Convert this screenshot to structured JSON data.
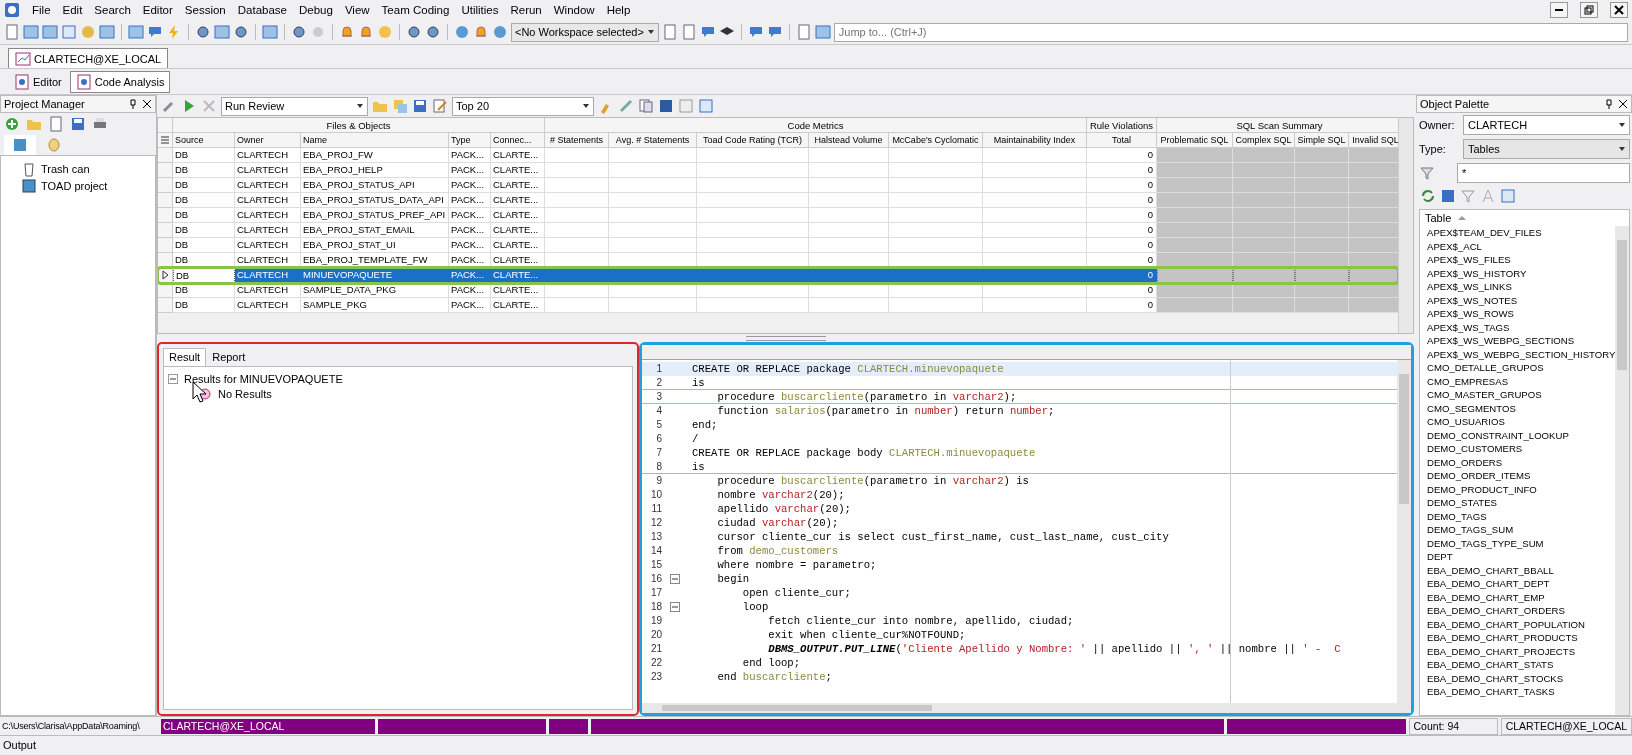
{
  "menu": [
    "File",
    "Edit",
    "Search",
    "Editor",
    "Session",
    "Database",
    "Debug",
    "View",
    "Team Coding",
    "Utilities",
    "Rerun",
    "Window",
    "Help"
  ],
  "toolbar": {
    "workspace": "<No Workspace selected>",
    "jump_placeholder": "Jump to... (Ctrl+J)"
  },
  "connection_tabs": [
    {
      "label": "CLARTECH@XE_LOCAL",
      "selected": true
    }
  ],
  "editor_tabs": [
    {
      "label": "Editor",
      "selected": false
    },
    {
      "label": "Code Analysis",
      "selected": true
    }
  ],
  "project_manager": {
    "title": "Project Manager",
    "items": [
      {
        "label": "Trash can",
        "kind": "trash"
      },
      {
        "label": "TOAD project",
        "kind": "project"
      }
    ]
  },
  "review_toolbar": {
    "action": "Run Review",
    "limit": "Top 20"
  },
  "grid": {
    "groups": [
      {
        "label": "Files & Objects",
        "columns": [
          "Source",
          "Owner",
          "Name",
          "Type",
          "Connec..."
        ]
      },
      {
        "label": "Code Metrics",
        "columns": [
          "# Statements",
          "Avg. # Statements",
          "Toad Code Rating (TCR)",
          "Halstead Volume",
          "McCabe's Cyclomatic",
          "Maintainability Index"
        ]
      },
      {
        "label": "Rule Violations",
        "columns": [
          "Total"
        ]
      },
      {
        "label": "SQL Scan Summary",
        "columns": [
          "Problematic SQL",
          "Complex SQL",
          "Simple SQL",
          "Invalid SQL"
        ]
      }
    ],
    "rows": [
      {
        "source": "DB",
        "owner": "CLARTECH",
        "name": "EBA_PROJ_FW",
        "type": "PACK...",
        "connection": "CLARTE...",
        "total": "0",
        "selected": false
      },
      {
        "source": "DB",
        "owner": "CLARTECH",
        "name": "EBA_PROJ_HELP",
        "type": "PACK...",
        "connection": "CLARTE...",
        "total": "0",
        "selected": false
      },
      {
        "source": "DB",
        "owner": "CLARTECH",
        "name": "EBA_PROJ_STATUS_API",
        "type": "PACK...",
        "connection": "CLARTE...",
        "total": "0",
        "selected": false
      },
      {
        "source": "DB",
        "owner": "CLARTECH",
        "name": "EBA_PROJ_STATUS_DATA_API",
        "type": "PACK...",
        "connection": "CLARTE...",
        "total": "0",
        "selected": false
      },
      {
        "source": "DB",
        "owner": "CLARTECH",
        "name": "EBA_PROJ_STATUS_PREF_API",
        "type": "PACK...",
        "connection": "CLARTE...",
        "total": "0",
        "selected": false
      },
      {
        "source": "DB",
        "owner": "CLARTECH",
        "name": "EBA_PROJ_STAT_EMAIL",
        "type": "PACK...",
        "connection": "CLARTE...",
        "total": "0",
        "selected": false
      },
      {
        "source": "DB",
        "owner": "CLARTECH",
        "name": "EBA_PROJ_STAT_UI",
        "type": "PACK...",
        "connection": "CLARTE...",
        "total": "0",
        "selected": false
      },
      {
        "source": "DB",
        "owner": "CLARTECH",
        "name": "EBA_PROJ_TEMPLATE_FW",
        "type": "PACK...",
        "connection": "CLARTE...",
        "total": "0",
        "selected": false
      },
      {
        "source": "DB",
        "owner": "CLARTECH",
        "name": "MINUEVOPAQUETE",
        "type": "PACK...",
        "connection": "CLARTE...",
        "total": "0",
        "selected": true
      },
      {
        "source": "DB",
        "owner": "CLARTECH",
        "name": "SAMPLE_DATA_PKG",
        "type": "PACK...",
        "connection": "CLARTE...",
        "total": "0",
        "selected": false
      },
      {
        "source": "DB",
        "owner": "CLARTECH",
        "name": "SAMPLE_PKG",
        "type": "PACK...",
        "connection": "CLARTE...",
        "total": "0",
        "selected": false
      }
    ]
  },
  "result_tabs": [
    {
      "label": "Result",
      "selected": true
    },
    {
      "label": "Report",
      "selected": false
    }
  ],
  "results_tree": {
    "label": "Results for MINUEVOPAQUETE",
    "expanded": true,
    "children": [
      {
        "label": "No Results"
      }
    ]
  },
  "code": {
    "lines": [
      {
        "number": "1",
        "current": true,
        "separator": false,
        "fold": false,
        "segments": [
          {
            "text": "CREATE OR REPLACE package ",
            "kind": "plain"
          },
          {
            "text": "CLARTECH.minuevopaquete",
            "kind": "ident"
          }
        ]
      },
      {
        "number": "2",
        "current": false,
        "separator": true,
        "fold": false,
        "segments": [
          {
            "text": "is",
            "kind": "plain"
          }
        ]
      },
      {
        "number": "3",
        "current": false,
        "separator": true,
        "fold": false,
        "segments": [
          {
            "text": "    procedure ",
            "kind": "plain"
          },
          {
            "text": "buscarcliente",
            "kind": "ident"
          },
          {
            "text": "(parametro in ",
            "kind": "plain"
          },
          {
            "text": "varchar2",
            "kind": "type"
          },
          {
            "text": ");",
            "kind": "plain"
          }
        ]
      },
      {
        "number": "4",
        "current": false,
        "separator": false,
        "fold": false,
        "segments": [
          {
            "text": "    function ",
            "kind": "plain"
          },
          {
            "text": "salarios",
            "kind": "ident"
          },
          {
            "text": "(parametro in ",
            "kind": "plain"
          },
          {
            "text": "number",
            "kind": "type"
          },
          {
            "text": ") return ",
            "kind": "plain"
          },
          {
            "text": "number",
            "kind": "type"
          },
          {
            "text": ";",
            "kind": "plain"
          }
        ]
      },
      {
        "number": "5",
        "current": false,
        "separator": false,
        "fold": false,
        "segments": [
          {
            "text": "end;",
            "kind": "plain"
          }
        ]
      },
      {
        "number": "6",
        "current": false,
        "separator": false,
        "fold": false,
        "segments": [
          {
            "text": "/",
            "kind": "plain"
          }
        ]
      },
      {
        "number": "7",
        "current": false,
        "separator": false,
        "fold": false,
        "segments": [
          {
            "text": "CREATE OR REPLACE package body ",
            "kind": "plain"
          },
          {
            "text": "CLARTECH.minuevopaquete",
            "kind": "ident"
          }
        ]
      },
      {
        "number": "8",
        "current": false,
        "separator": true,
        "fold": false,
        "segments": [
          {
            "text": "is",
            "kind": "plain"
          }
        ]
      },
      {
        "number": "9",
        "current": false,
        "separator": false,
        "fold": false,
        "segments": [
          {
            "text": "    procedure ",
            "kind": "plain"
          },
          {
            "text": "buscarcliente",
            "kind": "ident"
          },
          {
            "text": "(parametro in ",
            "kind": "plain"
          },
          {
            "text": "varchar2",
            "kind": "type"
          },
          {
            "text": ") is",
            "kind": "plain"
          }
        ]
      },
      {
        "number": "10",
        "current": false,
        "separator": false,
        "fold": false,
        "segments": [
          {
            "text": "    nombre ",
            "kind": "plain"
          },
          {
            "text": "varchar2",
            "kind": "type"
          },
          {
            "text": "(20);",
            "kind": "plain"
          }
        ]
      },
      {
        "number": "11",
        "current": false,
        "separator": false,
        "fold": false,
        "segments": [
          {
            "text": "    apellido ",
            "kind": "plain"
          },
          {
            "text": "varchar",
            "kind": "type"
          },
          {
            "text": "(20);",
            "kind": "plain"
          }
        ]
      },
      {
        "number": "12",
        "current": false,
        "separator": false,
        "fold": false,
        "segments": [
          {
            "text": "    ciudad ",
            "kind": "plain"
          },
          {
            "text": "varchar",
            "kind": "type"
          },
          {
            "text": "(20);",
            "kind": "plain"
          }
        ]
      },
      {
        "number": "13",
        "current": false,
        "separator": false,
        "fold": false,
        "segments": [
          {
            "text": "    cursor cliente_cur is select cust_first_name, cust_last_name, cust_city",
            "kind": "plain"
          }
        ]
      },
      {
        "number": "14",
        "current": false,
        "separator": false,
        "fold": false,
        "segments": [
          {
            "text": "    from ",
            "kind": "plain"
          },
          {
            "text": "demo_customers",
            "kind": "ident"
          }
        ]
      },
      {
        "number": "15",
        "current": false,
        "separator": false,
        "fold": false,
        "segments": [
          {
            "text": "    where nombre = parametro;",
            "kind": "plain"
          }
        ]
      },
      {
        "number": "16",
        "current": false,
        "separator": false,
        "fold": true,
        "segments": [
          {
            "text": "    begin",
            "kind": "plain"
          }
        ]
      },
      {
        "number": "17",
        "current": false,
        "separator": false,
        "fold": false,
        "segments": [
          {
            "text": "        open cliente_cur;",
            "kind": "plain"
          }
        ]
      },
      {
        "number": "18",
        "current": false,
        "separator": false,
        "fold": true,
        "segments": [
          {
            "text": "        loop",
            "kind": "plain"
          }
        ]
      },
      {
        "number": "19",
        "current": false,
        "separator": false,
        "fold": false,
        "segments": [
          {
            "text": "            fetch cliente_cur into nombre, apellido, ciudad;",
            "kind": "plain"
          }
        ]
      },
      {
        "number": "20",
        "current": false,
        "separator": false,
        "fold": false,
        "segments": [
          {
            "text": "            exit when cliente_cur%NOTFOUND;",
            "kind": "plain"
          }
        ]
      },
      {
        "number": "21",
        "current": false,
        "separator": false,
        "fold": false,
        "segments": [
          {
            "text": "            DBMS_OUTPUT.PUT_LINE",
            "kind": "call"
          },
          {
            "text": "(",
            "kind": "plain"
          },
          {
            "text": "'Cliente Apellido y Nombre: '",
            "kind": "str"
          },
          {
            "text": " || apellido || ",
            "kind": "plain"
          },
          {
            "text": "', '",
            "kind": "str"
          },
          {
            "text": " || nombre || ",
            "kind": "plain"
          },
          {
            "text": "' -  C",
            "kind": "str"
          }
        ]
      },
      {
        "number": "22",
        "current": false,
        "separator": false,
        "fold": false,
        "segments": [
          {
            "text": "        end loop;",
            "kind": "plain"
          }
        ]
      },
      {
        "number": "23",
        "current": false,
        "separator": false,
        "fold": false,
        "segments": [
          {
            "text": "    end ",
            "kind": "plain"
          },
          {
            "text": "buscarcliente",
            "kind": "ident"
          },
          {
            "text": ";",
            "kind": "plain"
          }
        ]
      }
    ]
  },
  "object_palette": {
    "title": "Object Palette",
    "owner_label": "Owner:",
    "owner": "CLARTECH",
    "type_label": "Type:",
    "type": "Tables",
    "filter": "*",
    "list_header": "Table",
    "items": [
      "APEX$TEAM_DEV_FILES",
      "APEX$_ACL",
      "APEX$_WS_FILES",
      "APEX$_WS_HISTORY",
      "APEX$_WS_LINKS",
      "APEX$_WS_NOTES",
      "APEX$_WS_ROWS",
      "APEX$_WS_TAGS",
      "APEX$_WS_WEBPG_SECTIONS",
      "APEX$_WS_WEBPG_SECTION_HISTORY",
      "CMO_DETALLE_GRUPOS",
      "CMO_EMPRESAS",
      "CMO_MASTER_GRUPOS",
      "CMO_SEGMENTOS",
      "CMO_USUARIOS",
      "DEMO_CONSTRAINT_LOOKUP",
      "DEMO_CUSTOMERS",
      "DEMO_ORDERS",
      "DEMO_ORDER_ITEMS",
      "DEMO_PRODUCT_INFO",
      "DEMO_STATES",
      "DEMO_TAGS",
      "DEMO_TAGS_SUM",
      "DEMO_TAGS_TYPE_SUM",
      "DEPT",
      "EBA_DEMO_CHART_BBALL",
      "EBA_DEMO_CHART_DEPT",
      "EBA_DEMO_CHART_EMP",
      "EBA_DEMO_CHART_ORDERS",
      "EBA_DEMO_CHART_POPULATION",
      "EBA_DEMO_CHART_PRODUCTS",
      "EBA_DEMO_CHART_PROJECTS",
      "EBA_DEMO_CHART_STATS",
      "EBA_DEMO_CHART_STOCKS",
      "EBA_DEMO_CHART_TASKS"
    ]
  },
  "status_bar": {
    "path": "C:\\Users\\Clarisa\\AppData\\Roaming\\",
    "connection": "CLARTECH@XE_LOCAL",
    "count": "Count: 94",
    "palette_connection": "CLARTECH@XE_LOCAL"
  },
  "output": {
    "title": "Output"
  }
}
